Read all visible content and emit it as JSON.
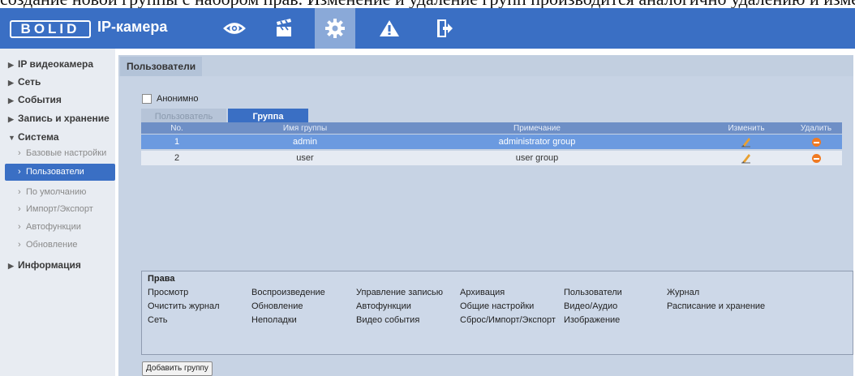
{
  "document": {
    "caption_fragment": "создание новой группы с набором прав. Изменение и удаление групп производится аналогично удалению и изменению пользователей"
  },
  "header": {
    "logo_text": "BOLID",
    "app_title": "IP-камера",
    "nav_icons": [
      "eye-icon",
      "clapperboard-icon",
      "gear-icon",
      "warning-icon",
      "exit-icon"
    ],
    "active_nav": "gear-icon",
    "accent_color": "#3a6fc4"
  },
  "sidebar": {
    "sections": [
      {
        "label": "IP видеокамера",
        "arrow": "▶"
      },
      {
        "label": "Сеть",
        "arrow": "▶"
      },
      {
        "label": "События",
        "arrow": "▶"
      },
      {
        "label": "Запись и хранение",
        "arrow": "▶"
      },
      {
        "label": "Система",
        "arrow": "▼"
      },
      {
        "label": "Информация",
        "arrow": "▶"
      }
    ],
    "system_items": [
      {
        "label": "Базовые настройки",
        "active": false
      },
      {
        "label": "Пользователи",
        "active": true
      },
      {
        "label": "По умолчанию",
        "active": false
      },
      {
        "label": "Импорт/Экспорт",
        "active": false
      },
      {
        "label": "Автофункции",
        "active": false
      },
      {
        "label": "Обновление",
        "active": false
      }
    ]
  },
  "main": {
    "page_tab": "Пользователи",
    "anonymous_label": "Анонимно",
    "anonymous_checked": false,
    "subtabs": [
      {
        "label": "Пользователь",
        "active": false
      },
      {
        "label": "Группа",
        "active": true
      }
    ],
    "table": {
      "columns": [
        "No.",
        "Имя группы",
        "Примечание",
        "Изменить",
        "Удалить"
      ],
      "rows": [
        {
          "no": "1",
          "name": "admin",
          "note": "administrator group",
          "selected": true
        },
        {
          "no": "2",
          "name": "user",
          "note": "user group",
          "selected": false
        }
      ]
    },
    "rights": {
      "title": "Права",
      "items": [
        [
          "Просмотр",
          "Воспроизведение",
          "Управление записью",
          "Архивация",
          "Пользователи",
          "Журнал"
        ],
        [
          "Очистить журнал",
          "Обновление",
          "Автофункции",
          "Общие настройки",
          "Видео/Аудио",
          "Расписание и хранение"
        ],
        [
          "Сеть",
          "Неполадки",
          "Видео события",
          "Сброс/Импорт/Экспорт",
          "Изображение"
        ]
      ]
    },
    "add_group_button": "Добавить группу"
  }
}
